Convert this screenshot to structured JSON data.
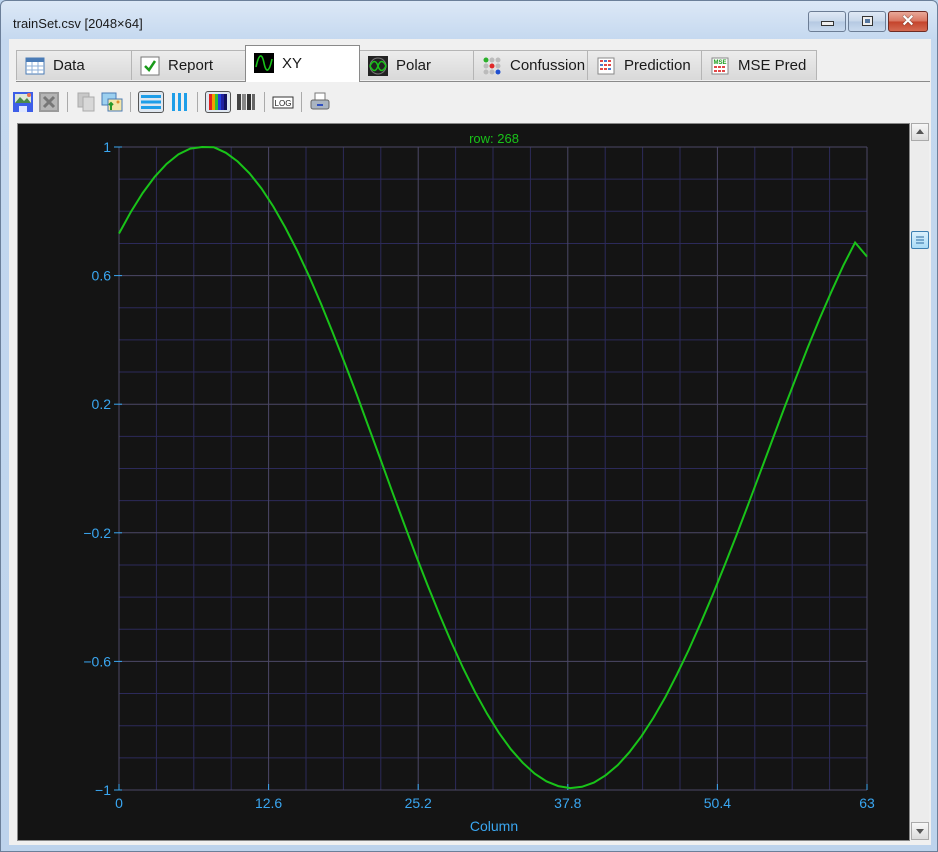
{
  "window": {
    "title": "trainSet.csv [2048×64]",
    "controls": [
      "minimize",
      "maximize",
      "close"
    ]
  },
  "tabs": [
    {
      "label": "Data",
      "icon": "table-icon",
      "active": false
    },
    {
      "label": "Report",
      "icon": "checkmark-icon",
      "active": false
    },
    {
      "label": "XY",
      "icon": "sine-wave-icon",
      "active": true
    },
    {
      "label": "Polar",
      "icon": "polar-icon",
      "active": false
    },
    {
      "label": "Confussion",
      "icon": "confusion-matrix-icon",
      "active": false
    },
    {
      "label": "Prediction",
      "icon": "prediction-grid-icon",
      "active": false
    },
    {
      "label": "MSE Pred",
      "icon": "mse-grid-icon",
      "active": false
    }
  ],
  "toolbar": [
    {
      "name": "save-image-button",
      "icon": "save-image-icon"
    },
    {
      "name": "export-excel-button",
      "icon": "excel-icon",
      "disabled": true
    },
    {
      "name": "copy-button",
      "icon": "copy-icon",
      "disabled": true
    },
    {
      "name": "copy-image-button",
      "icon": "images-icon"
    },
    {
      "name": "horizontal-grid-button",
      "icon": "horizontal-lines-icon",
      "pressed": true
    },
    {
      "name": "vertical-grid-button",
      "icon": "vertical-lines-icon"
    },
    {
      "name": "color-mode-button",
      "icon": "color-bars-icon",
      "pressed": true
    },
    {
      "name": "grayscale-mode-button",
      "icon": "gray-bars-icon"
    },
    {
      "name": "log-scale-button",
      "icon": "log-icon",
      "label": "LOG"
    },
    {
      "name": "print-button",
      "icon": "printer-icon"
    }
  ],
  "colors": {
    "curve": "#19c319",
    "axis_text": "#3aa6f0",
    "grid_major": "#4c4866",
    "grid_minor": "#2c2a5a",
    "background": "#141414",
    "title_text": "#19c319"
  },
  "chart_data": {
    "type": "line",
    "title": "row: 268",
    "xlabel": "Column",
    "ylabel": "",
    "xlim": [
      0,
      63
    ],
    "ylim": [
      -1,
      1
    ],
    "xticks": [
      0,
      12.6,
      25.2,
      37.8,
      50.4,
      63
    ],
    "xtick_labels": [
      "0",
      "12.6",
      "25.2",
      "37.8",
      "50.4",
      "63"
    ],
    "yticks": [
      1,
      0.6,
      0.2,
      -0.2,
      -0.6,
      -1
    ],
    "ytick_labels": [
      "1",
      "0.6",
      "0.2",
      "−0.2",
      "−0.6",
      "−1"
    ],
    "grid": true,
    "legend": "none",
    "series": [
      {
        "name": "row 268",
        "x": [
          0,
          1,
          2,
          3,
          4,
          5,
          6,
          7,
          8,
          9,
          10,
          11,
          12,
          13,
          14,
          15,
          16,
          17,
          18,
          19,
          20,
          21,
          22,
          23,
          24,
          25,
          26,
          27,
          28,
          29,
          30,
          31,
          32,
          33,
          34,
          35,
          36,
          37,
          38,
          39,
          40,
          41,
          42,
          43,
          44,
          45,
          46,
          47,
          48,
          49,
          50,
          51,
          52,
          53,
          54,
          55,
          56,
          57,
          58,
          59,
          60,
          61,
          62,
          63
        ],
        "values": [
          0.731,
          0.798,
          0.857,
          0.907,
          0.947,
          0.977,
          0.995,
          1.0,
          0.999,
          0.982,
          0.955,
          0.918,
          0.871,
          0.815,
          0.75,
          0.678,
          0.599,
          0.514,
          0.423,
          0.329,
          0.232,
          0.132,
          0.031,
          -0.071,
          -0.171,
          -0.269,
          -0.364,
          -0.455,
          -0.541,
          -0.622,
          -0.696,
          -0.763,
          -0.822,
          -0.873,
          -0.915,
          -0.949,
          -0.973,
          -0.988,
          -0.994,
          -0.99,
          -0.977,
          -0.954,
          -0.923,
          -0.882,
          -0.833,
          -0.776,
          -0.712,
          -0.64,
          -0.563,
          -0.48,
          -0.393,
          -0.302,
          -0.208,
          -0.111,
          -0.013,
          0.086,
          0.185,
          0.281,
          0.375,
          0.465,
          0.55,
          0.631,
          0.703,
          0.659
        ]
      }
    ]
  }
}
